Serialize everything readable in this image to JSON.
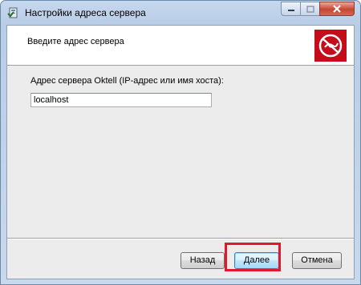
{
  "window": {
    "title": "Настройки адреса сервера",
    "icon": "installer-icon",
    "controls": [
      "minimize-icon",
      "maximize-icon",
      "close-icon"
    ]
  },
  "banner": {
    "instruction": "Введите адрес сервера",
    "logo": "oktell-logo-icon",
    "logo_color": "#c40c1a"
  },
  "form": {
    "label": "Адрес сервера Oktell (IP-адрес или имя хоста):",
    "server_value": "localhost"
  },
  "buttons": {
    "back": "Назад",
    "next": "Далее",
    "cancel": "Отмена"
  },
  "annotation": {
    "highlight_target": "next-button",
    "highlight_color": "#e0182c"
  }
}
